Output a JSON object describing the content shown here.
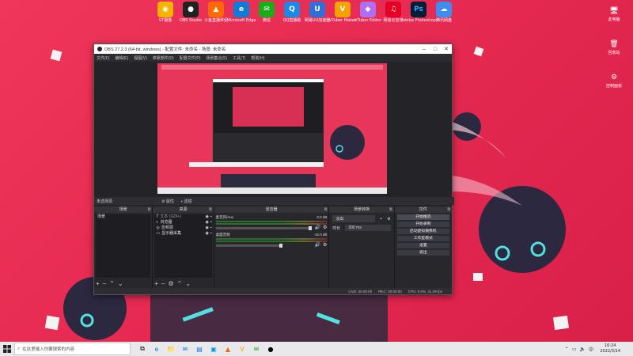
{
  "desktop": {
    "top_icons": [
      {
        "label": "VT摄像",
        "icon": "vt-camera-icon",
        "color": "#f5b400",
        "glyph": "◉"
      },
      {
        "label": "OBS Studio",
        "icon": "obs-icon",
        "color": "#222222",
        "glyph": "●"
      },
      {
        "label": "斗鱼直播伴侣",
        "icon": "douyu-icon",
        "color": "#ff6a00",
        "glyph": "▲"
      },
      {
        "label": "Microsoft Edge",
        "icon": "edge-icon",
        "color": "#0f7bd8",
        "glyph": "e"
      },
      {
        "label": "微信",
        "icon": "wechat-icon",
        "color": "#1aad19",
        "glyph": "✉"
      },
      {
        "label": "QQ直播助",
        "icon": "qq-icon",
        "color": "#1e88e5",
        "glyph": "Q"
      },
      {
        "label": "网易UU加速器",
        "icon": "uu-icon",
        "color": "#2f6fd6",
        "glyph": "U"
      },
      {
        "label": "VTuber Maker",
        "icon": "vtuber-maker-icon",
        "color": "#f3a400",
        "glyph": "V"
      },
      {
        "label": "VTuber Editor",
        "icon": "vtuber-editor-icon",
        "color": "#b06ef0",
        "glyph": "◆"
      },
      {
        "label": "网易云音乐",
        "icon": "netease-music-icon",
        "color": "#e60026",
        "glyph": "♫"
      },
      {
        "label": "Adobe Photoshop",
        "icon": "photoshop-icon",
        "color": "#001e36",
        "glyph": "Ps"
      },
      {
        "label": "腾讯网盘",
        "icon": "tencent-drive-icon",
        "color": "#3c8ef0",
        "glyph": "☁"
      }
    ],
    "right_icons": [
      {
        "label": "此电脑",
        "icon": "this-pc-icon",
        "glyph": "🖥"
      },
      {
        "label": "回收站",
        "icon": "recycle-bin-icon",
        "glyph": "🗑"
      },
      {
        "label": "控制面板",
        "icon": "control-panel-icon",
        "glyph": "⚙"
      }
    ]
  },
  "obs": {
    "title": "OBS 27.2.3 (64-bit, windows) - 配置文件: 未命名 - 场景: 未命名",
    "menu": [
      "文件(F)",
      "编辑(E)",
      "视图(V)",
      "停靠部件(D)",
      "配置文件(P)",
      "场景集合(S)",
      "工具(T)",
      "帮助(H)"
    ],
    "scene_bar": {
      "label": "未选择源",
      "properties": "属性",
      "filters": "滤镜"
    },
    "docks": {
      "scenes": {
        "title": "场景",
        "items": [
          "场景"
        ]
      },
      "sources": {
        "title": "来源",
        "items": [
          {
            "label": "文本 (GDI+)",
            "icon": "text-icon",
            "glyph": "T"
          },
          {
            "label": "浏览器",
            "icon": "browser-icon",
            "glyph": "◐"
          },
          {
            "label": "音频源",
            "icon": "audio-source-icon",
            "glyph": "◎"
          },
          {
            "label": "显示器采集",
            "icon": "monitor-icon",
            "glyph": "▭"
          }
        ]
      },
      "mixer": {
        "title": "混音器",
        "tracks": [
          {
            "name": "麦克风/Aux",
            "db": "0.0 dB"
          },
          {
            "name": "桌面音频",
            "db": "-15.0 dB"
          }
        ]
      },
      "transitions": {
        "title": "场景转换",
        "type": "淡出",
        "duration_label": "时长",
        "duration": "300 ms"
      },
      "controls": {
        "title": "控件",
        "buttons": [
          "开始推流",
          "开始录制",
          "启动虚拟摄像机",
          "工作室模式",
          "设置",
          "退出"
        ]
      }
    },
    "status": {
      "live": "LIVE: 00:00:00",
      "rec": "REC: 00:00:00",
      "cpu": "CPU: 0.0%, 31.09 fps"
    }
  },
  "taskbar": {
    "search_placeholder": "在这里输入你要搜索的内容",
    "apps": [
      {
        "icon": "task-view-icon",
        "glyph": "⧉"
      },
      {
        "icon": "edge-icon",
        "glyph": "e"
      },
      {
        "icon": "file-explorer-icon",
        "glyph": "📁"
      },
      {
        "icon": "mail-icon",
        "glyph": "✉"
      },
      {
        "icon": "store-icon",
        "glyph": "▤"
      },
      {
        "icon": "bilibili-icon",
        "glyph": "▣"
      },
      {
        "icon": "douyu-icon",
        "glyph": "▲"
      },
      {
        "icon": "vtuber-maker-icon",
        "glyph": "V"
      },
      {
        "icon": "wechat-icon",
        "glyph": "✉"
      },
      {
        "icon": "obs-icon",
        "glyph": "●"
      }
    ],
    "time": "16:24",
    "date": "2022/3/14"
  }
}
